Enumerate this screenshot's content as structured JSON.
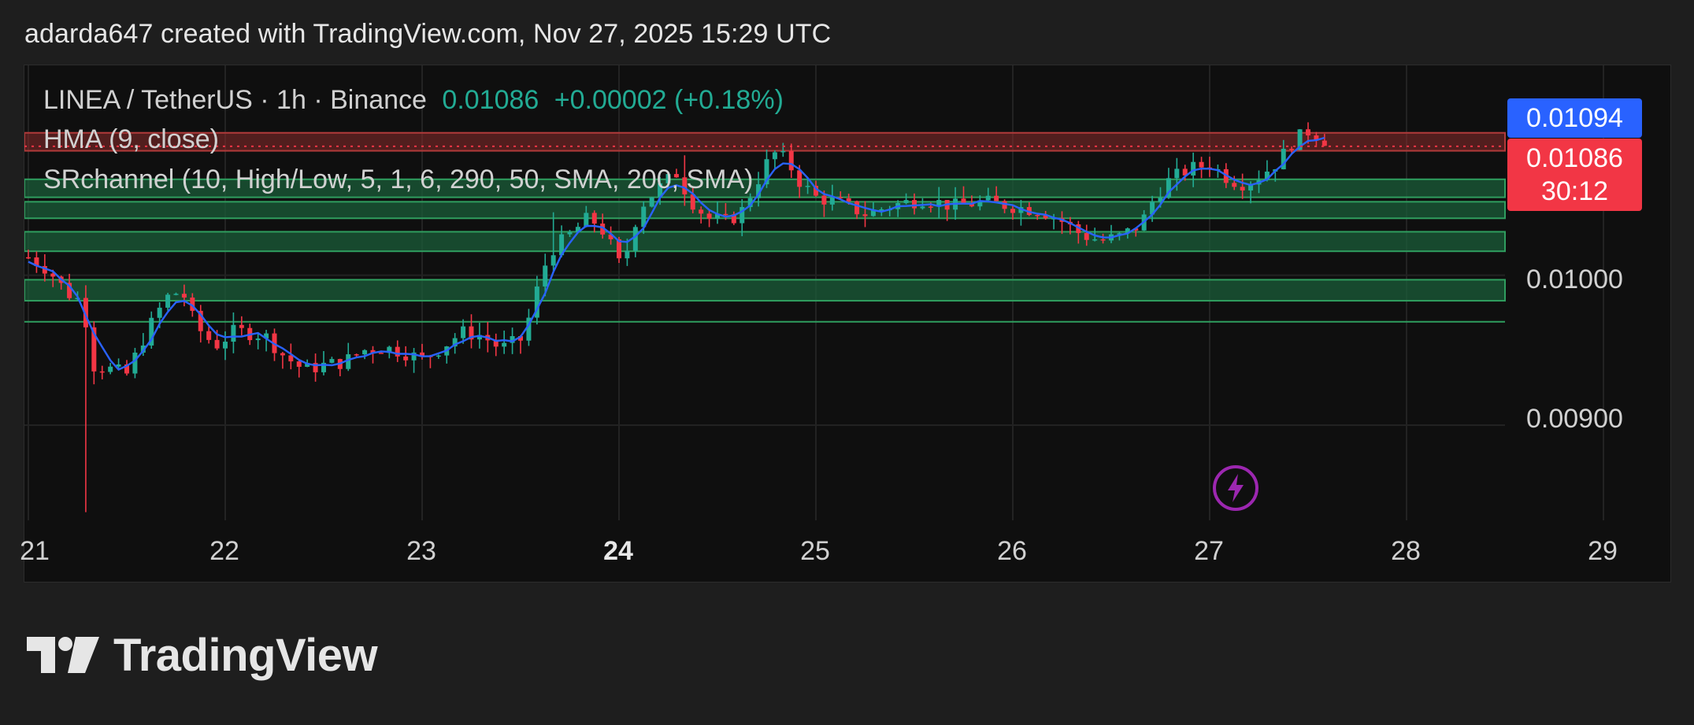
{
  "header": {
    "caption": "adarda647 created with TradingView.com, Nov 27, 2025 15:29 UTC"
  },
  "legend": {
    "symbol_label": "LINEA / TetherUS · 1h · Binance",
    "last_price": "0.01086",
    "change": "+0.00002 (+0.18%)",
    "hma_label": "HMA (9, close)",
    "sr_label": "SRchannel (10, High/Low, 5, 1, 6, 290, 50, SMA, 200, SMA)"
  },
  "price_tags": {
    "top_value": "0.01094",
    "last_value": "0.01086",
    "countdown": "30:12"
  },
  "y_ticks": [
    "0.01000",
    "0.00900"
  ],
  "x_ticks": [
    {
      "label": "21",
      "bold": false
    },
    {
      "label": "22",
      "bold": false
    },
    {
      "label": "23",
      "bold": false
    },
    {
      "label": "24",
      "bold": true
    },
    {
      "label": "25",
      "bold": false
    },
    {
      "label": "26",
      "bold": false
    },
    {
      "label": "27",
      "bold": false
    },
    {
      "label": "28",
      "bold": false
    },
    {
      "label": "29",
      "bold": false
    }
  ],
  "logo": {
    "text": "TradingView"
  },
  "colors": {
    "up": "#22ab94",
    "down": "#f23645",
    "hma": "#2962ff",
    "sr_fill": "#1b5e3a",
    "sr_resistance": "#8a2b2b",
    "accent_bolt": "#9c27b0"
  },
  "chart_data": {
    "type": "candlestick",
    "title": "LINEA / TetherUS · 1h · Binance",
    "x_axis": "date (Nov 2025)",
    "y_range": [
      0.00825,
      0.0114
    ],
    "x_range": [
      20.98,
      29.0
    ],
    "last_price": 0.01086,
    "sr_channels": [
      {
        "low": 0.01083,
        "high": 0.01095,
        "type": "resistance"
      },
      {
        "low": 0.01052,
        "high": 0.01064,
        "type": "support"
      },
      {
        "low": 0.01038,
        "high": 0.01049,
        "type": "support"
      },
      {
        "low": 0.01016,
        "high": 0.01029,
        "type": "support"
      },
      {
        "low": 0.00983,
        "high": 0.00997,
        "type": "support"
      }
    ],
    "sr_lines": [
      0.00969
    ],
    "candles_anchor": [
      [
        21.0,
        0.01012
      ],
      [
        21.1,
        0.01004
      ],
      [
        21.2,
        0.00988
      ],
      [
        21.28,
        0.00982
      ],
      [
        21.32,
        0.0094
      ],
      [
        21.4,
        0.00938
      ],
      [
        21.5,
        0.00934
      ],
      [
        21.6,
        0.00962
      ],
      [
        21.7,
        0.00985
      ],
      [
        21.78,
        0.0099
      ],
      [
        21.85,
        0.00966
      ],
      [
        21.95,
        0.00953
      ],
      [
        22.05,
        0.00963
      ],
      [
        22.2,
        0.0096
      ],
      [
        22.3,
        0.00946
      ],
      [
        22.4,
        0.00937
      ],
      [
        22.5,
        0.0094
      ],
      [
        22.6,
        0.00942
      ],
      [
        22.7,
        0.0095
      ],
      [
        22.8,
        0.00952
      ],
      [
        22.9,
        0.00949
      ],
      [
        23.0,
        0.00944
      ],
      [
        23.1,
        0.00952
      ],
      [
        23.2,
        0.00962
      ],
      [
        23.3,
        0.0096
      ],
      [
        23.4,
        0.00951
      ],
      [
        23.5,
        0.00957
      ],
      [
        23.55,
        0.00974
      ],
      [
        23.6,
        0.00998
      ],
      [
        23.65,
        0.01016
      ],
      [
        23.75,
        0.01027
      ],
      [
        23.85,
        0.01039
      ],
      [
        23.93,
        0.01028
      ],
      [
        24.0,
        0.01008
      ],
      [
        24.05,
        0.01019
      ],
      [
        24.1,
        0.01045
      ],
      [
        24.2,
        0.01058
      ],
      [
        24.3,
        0.01069
      ],
      [
        24.35,
        0.01052
      ],
      [
        24.45,
        0.01038
      ],
      [
        24.55,
        0.01036
      ],
      [
        24.62,
        0.01042
      ],
      [
        24.7,
        0.01062
      ],
      [
        24.78,
        0.01082
      ],
      [
        24.85,
        0.01077
      ],
      [
        24.92,
        0.01062
      ],
      [
        25.0,
        0.01052
      ],
      [
        25.1,
        0.01049
      ],
      [
        25.25,
        0.01041
      ],
      [
        25.4,
        0.01047
      ],
      [
        25.55,
        0.01051
      ],
      [
        25.7,
        0.01046
      ],
      [
        25.85,
        0.01049
      ],
      [
        26.0,
        0.01046
      ],
      [
        26.15,
        0.01043
      ],
      [
        26.25,
        0.01036
      ],
      [
        26.35,
        0.01027
      ],
      [
        26.45,
        0.01023
      ],
      [
        26.55,
        0.01026
      ],
      [
        26.65,
        0.01034
      ],
      [
        26.72,
        0.01052
      ],
      [
        26.8,
        0.01064
      ],
      [
        26.9,
        0.01071
      ],
      [
        27.0,
        0.01074
      ],
      [
        27.1,
        0.01064
      ],
      [
        27.18,
        0.01061
      ],
      [
        27.25,
        0.01066
      ],
      [
        27.35,
        0.01076
      ],
      [
        27.42,
        0.01089
      ],
      [
        27.5,
        0.01096
      ],
      [
        27.57,
        0.01092
      ],
      [
        27.62,
        0.01086
      ]
    ]
  }
}
